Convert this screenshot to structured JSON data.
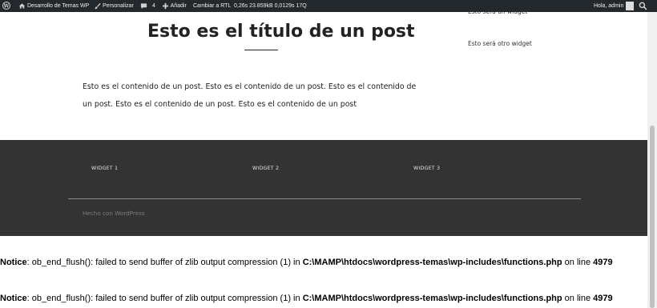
{
  "admin_bar": {
    "site_name": "Desarrollo de Temas WP",
    "customize": "Personalizar",
    "comments_count": "4",
    "new_label": "Añadir",
    "rtl_label": "Cambiar a RTL",
    "perf": "0,26s   23.859kB   0,0129s   17Q",
    "howdy": "Hola, admin"
  },
  "post": {
    "title": "Esto es el título de un post",
    "content": "Esto es el contenido de un post. Esto es el contenido de un post. Esto es el contenido de un post. Esto es el contenido de un post. Esto es el contenido de un post"
  },
  "sidebar": {
    "widget1": "Esto será un widget",
    "widget2": "Esto será otro widget"
  },
  "footer": {
    "widgets": [
      "WIDGET 1",
      "WIDGET 2",
      "WIDGET 3"
    ],
    "credit": "Hecho con WordPress"
  },
  "notices": [
    {
      "label": "Notice",
      "msg": ": ob_end_flush(): failed to send buffer of zlib output compression (1) in ",
      "path": "C:\\MAMP\\htdocs\\wordpress-temas\\wp-includes\\functions.php",
      "mid": " on line ",
      "line": "4979"
    },
    {
      "label": "Notice",
      "msg": ": ob_end_flush(): failed to send buffer of zlib output compression (1) in ",
      "path": "C:\\MAMP\\htdocs\\wordpress-temas\\wp-includes\\functions.php",
      "mid": " on line ",
      "line": "4979"
    }
  ],
  "colors": {
    "admin_bar_bg": "#23282d",
    "footer_bg": "#333333"
  }
}
